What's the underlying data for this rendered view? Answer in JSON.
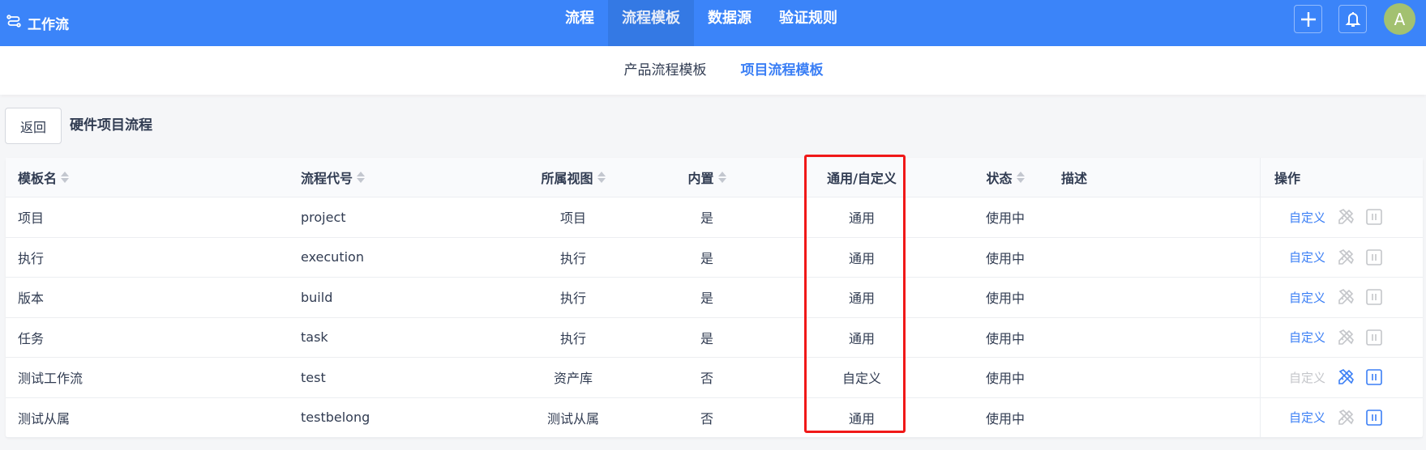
{
  "topbar": {
    "brand": "工作流",
    "nav": [
      {
        "label": "流程"
      },
      {
        "label": "流程模板",
        "active": true
      },
      {
        "label": "数据源"
      },
      {
        "label": "验证规则"
      }
    ],
    "avatar": "A"
  },
  "subnav": [
    {
      "label": "产品流程模板"
    },
    {
      "label": "项目流程模板",
      "active": true
    }
  ],
  "page": {
    "back": "返回",
    "title": "硬件项目流程"
  },
  "table": {
    "headers": [
      "模板名",
      "流程代号",
      "所属视图",
      "内置",
      "通用/自定义",
      "状态",
      "描述",
      "操作"
    ],
    "rows": [
      {
        "name": "项目",
        "code": "project",
        "view": "项目",
        "builtin": "是",
        "type": "通用",
        "status": "使用中",
        "desc": "",
        "action": "自定义",
        "custom_enabled": true,
        "edit_enabled": false,
        "pause_enabled": false
      },
      {
        "name": "执行",
        "code": "execution",
        "view": "执行",
        "builtin": "是",
        "type": "通用",
        "status": "使用中",
        "desc": "",
        "action": "自定义",
        "custom_enabled": true,
        "edit_enabled": false,
        "pause_enabled": false
      },
      {
        "name": "版本",
        "code": "build",
        "view": "执行",
        "builtin": "是",
        "type": "通用",
        "status": "使用中",
        "desc": "",
        "action": "自定义",
        "custom_enabled": true,
        "edit_enabled": false,
        "pause_enabled": false
      },
      {
        "name": "任务",
        "code": "task",
        "view": "执行",
        "builtin": "是",
        "type": "通用",
        "status": "使用中",
        "desc": "",
        "action": "自定义",
        "custom_enabled": true,
        "edit_enabled": false,
        "pause_enabled": false
      },
      {
        "name": "测试工作流",
        "code": "test",
        "view": "资产库",
        "builtin": "否",
        "type": "自定义",
        "status": "使用中",
        "desc": "",
        "action": "自定义",
        "custom_enabled": false,
        "edit_enabled": true,
        "pause_enabled": true
      },
      {
        "name": "测试从属",
        "code": "testbelong",
        "view": "测试从属",
        "builtin": "否",
        "type": "通用",
        "status": "使用中",
        "desc": "",
        "action": "自定义",
        "custom_enabled": true,
        "edit_enabled": false,
        "pause_enabled": true
      }
    ]
  },
  "colors": {
    "primary": "#3b84f9",
    "link": "#3b7ff5",
    "highlight": "#f01818",
    "disabled": "#c4c6ca"
  }
}
